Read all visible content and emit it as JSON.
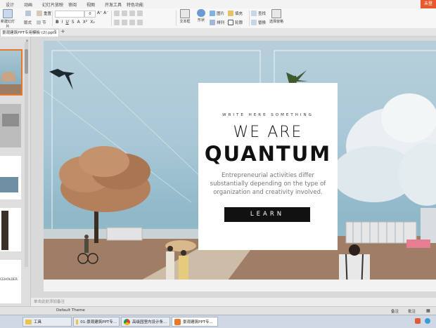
{
  "ribbon_tabs": [
    "设计",
    "动画",
    "幻灯片放映",
    "审阅",
    "视图",
    "开发工具",
    "特色功能"
  ],
  "login_badge": "未登",
  "ribbon": {
    "new_slide": "新建幻灯片",
    "layout": "版式",
    "section": "节",
    "reset": "重置",
    "font_size": "0",
    "textbox": "文本框",
    "shape": "形状",
    "picture": "图片",
    "arrange": "排列",
    "fill": "填充",
    "outline": "轮廓",
    "find": "查找",
    "replace": "替换",
    "select_pane": "选择窗格"
  },
  "doc_tab": "景观建筑PPT专用模板 (2).pptx",
  "new_tab": "+",
  "slide": {
    "tagline": "WRITE HERE SOMETHING",
    "title_line1": "WE ARE",
    "title_line2": "QUANTUM",
    "description": "Entrepreneurial activities differ substantially depending on the type of organization and creativity involved.",
    "button": "LEARN"
  },
  "thumb_placeholder": "CEHOLDER",
  "notes_placeholder": "单击此处添加备注",
  "status": {
    "theme": "Default Theme",
    "notes": "备注",
    "comment": "批注"
  },
  "taskbar": [
    {
      "label": "工具",
      "icon": "folder-icon"
    },
    {
      "label": "01-景观建筑PPT专...",
      "icon": "folder-icon"
    },
    {
      "label": "高级园室内设计条...",
      "icon": "chrome-icon"
    },
    {
      "label": "景观建筑PPT专...",
      "icon": "wps-presentation-icon"
    }
  ],
  "colors": {
    "accent": "#e8792c",
    "card_bg": "#ffffff",
    "button_bg": "#111111"
  }
}
